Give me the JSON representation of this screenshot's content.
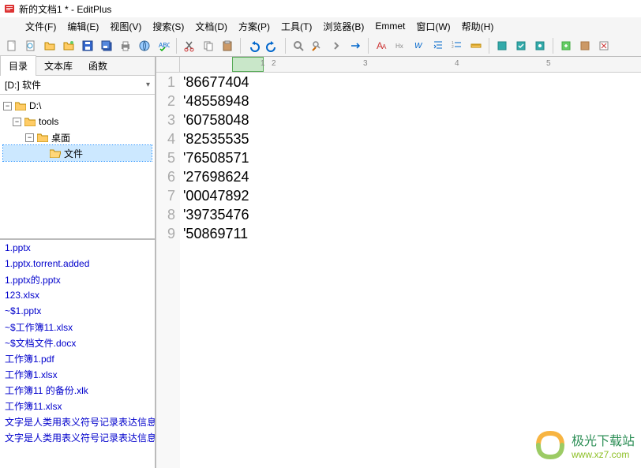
{
  "window": {
    "title": "新的文档1 * - EditPlus"
  },
  "menu": {
    "file": "文件(F)",
    "edit": "编辑(E)",
    "view": "视图(V)",
    "search": "搜索(S)",
    "document": "文档(D)",
    "project": "方案(P)",
    "tools": "工具(T)",
    "browser": "浏览器(B)",
    "emmet": "Emmet",
    "window": "窗口(W)",
    "help": "帮助(H)"
  },
  "left_tabs": {
    "t1": "目录",
    "t2": "文本库",
    "t3": "函数"
  },
  "drive_dropdown": "[D:] 软件",
  "tree": {
    "n1": "D:\\",
    "n2": "tools",
    "n3": "桌面",
    "n4": "文件"
  },
  "files": [
    "1.pptx",
    "1.pptx.torrent.added",
    "1.pptx的.pptx",
    "123.xlsx",
    "~$1.pptx",
    "~$工作簿11.xlsx",
    "~$文档文件.docx",
    "工作簿1.pdf",
    "工作簿1.xlsx",
    "工作簿11 的备份.xlk",
    "工作簿11.xlsx",
    "文字是人类用表义符号记录表达信息",
    "文字是人类用表义符号记录表达信息"
  ],
  "ruler": {
    "n1": "1",
    "n2": "2",
    "n3": "3",
    "n4": "4",
    "n5": "5"
  },
  "editor": {
    "lines": [
      {
        "num": "1",
        "text": "'86677404"
      },
      {
        "num": "2",
        "text": "'48558948"
      },
      {
        "num": "3",
        "text": "'60758048"
      },
      {
        "num": "4",
        "text": "'82535535"
      },
      {
        "num": "5",
        "text": "'76508571"
      },
      {
        "num": "6",
        "text": "'27698624"
      },
      {
        "num": "7",
        "text": "'00047892"
      },
      {
        "num": "8",
        "text": "'39735476"
      },
      {
        "num": "9",
        "text": "'50869711"
      }
    ]
  },
  "watermark": {
    "line1": "极光下载站",
    "line2": "www.xz7.com"
  }
}
